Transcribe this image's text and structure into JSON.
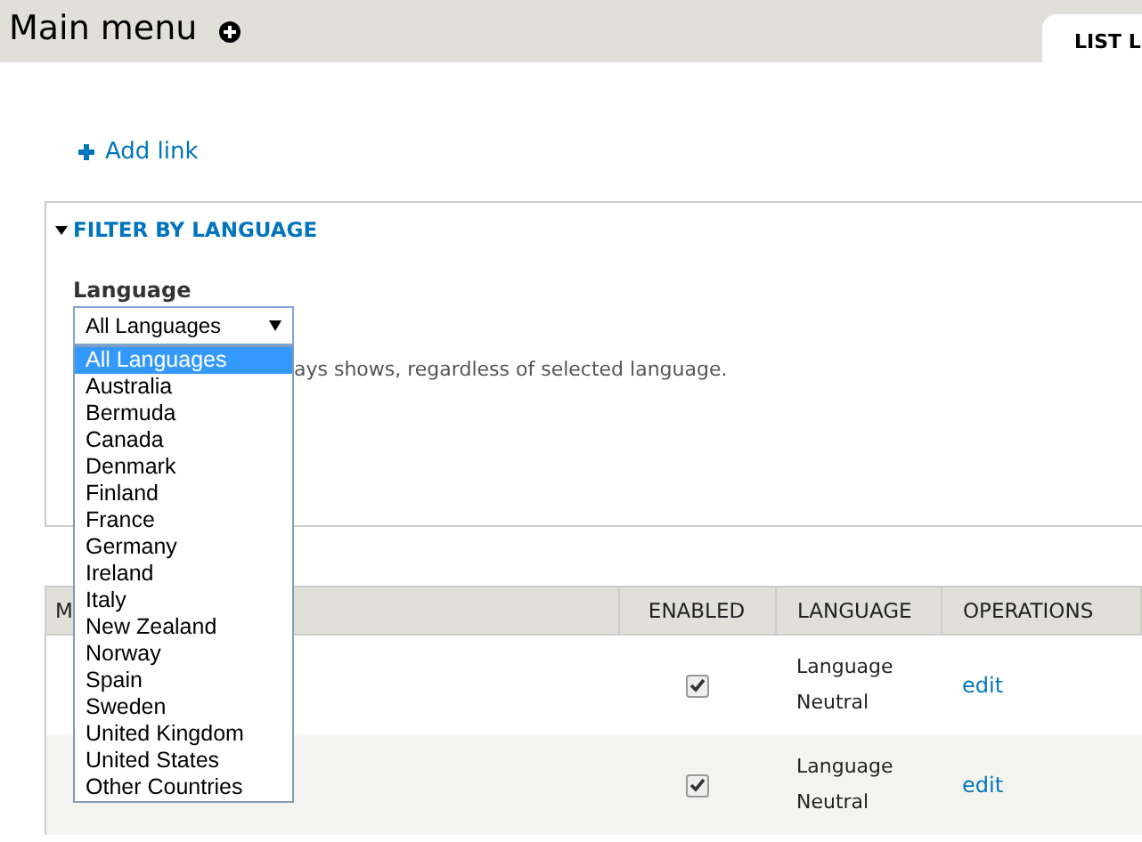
{
  "header": {
    "title": "Main menu",
    "tab": {
      "label": "LIST L",
      "selected": true
    }
  },
  "add_link": "Add link",
  "filter": {
    "legend": "FILTER BY LANGUAGE",
    "expanded": true,
    "label": "Language",
    "value": "All Languages",
    "description": "ays shows, regardless of selected language.",
    "options": [
      {
        "label": "All Languages",
        "selected": true
      },
      {
        "label": "Australia",
        "selected": false
      },
      {
        "label": "Bermuda",
        "selected": false
      },
      {
        "label": "Canada",
        "selected": false
      },
      {
        "label": "Denmark",
        "selected": false
      },
      {
        "label": "Finland",
        "selected": false
      },
      {
        "label": "France",
        "selected": false
      },
      {
        "label": "Germany",
        "selected": false
      },
      {
        "label": "Ireland",
        "selected": false
      },
      {
        "label": "Italy",
        "selected": false
      },
      {
        "label": "New Zealand",
        "selected": false
      },
      {
        "label": "Norway",
        "selected": false
      },
      {
        "label": "Spain",
        "selected": false
      },
      {
        "label": "Sweden",
        "selected": false
      },
      {
        "label": "United Kingdom",
        "selected": false
      },
      {
        "label": "United States",
        "selected": false
      },
      {
        "label": "Other Countries",
        "selected": false
      }
    ]
  },
  "table": {
    "columns": [
      "M",
      "ENABLED",
      "LANGUAGE",
      "OPERATIONS"
    ],
    "rows": [
      {
        "enabled": true,
        "language": [
          "Language",
          "Neutral"
        ],
        "operation": "edit"
      },
      {
        "enabled": true,
        "language": [
          "Language",
          "Neutral"
        ],
        "operation": "edit"
      }
    ]
  }
}
